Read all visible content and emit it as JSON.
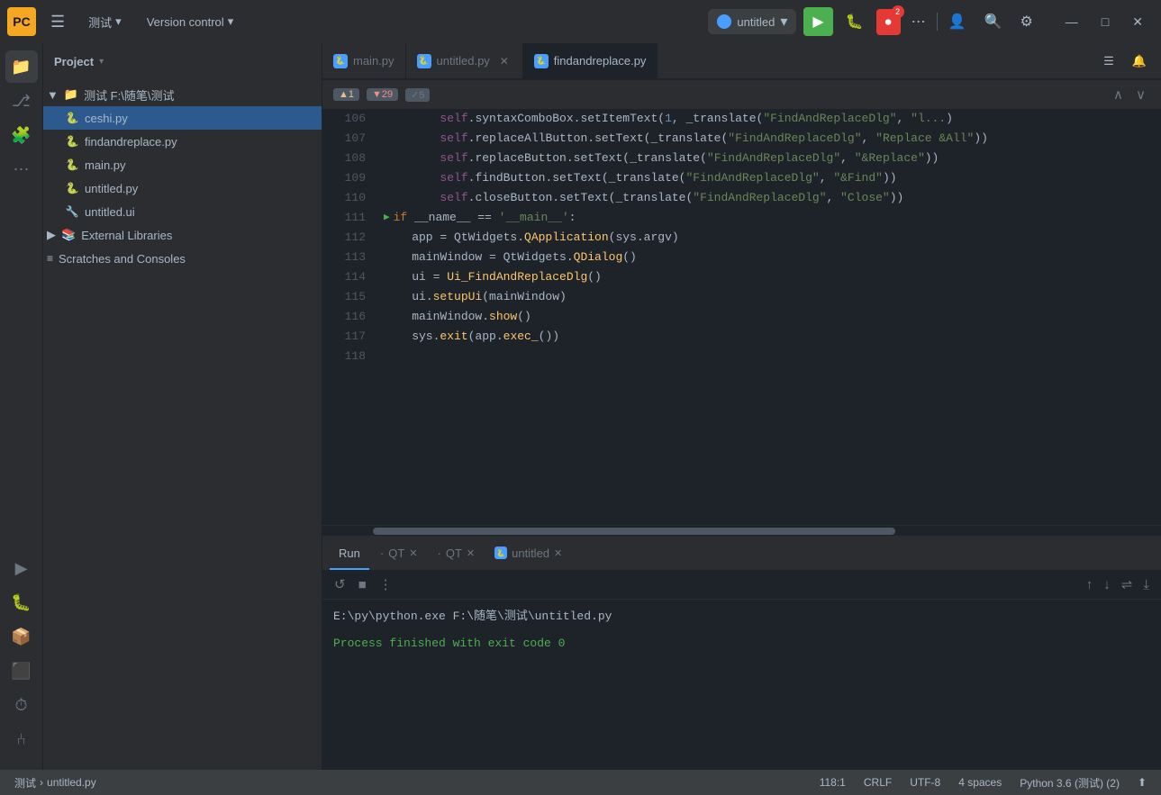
{
  "titlebar": {
    "logo": "PC",
    "menu_toggle": "☰",
    "menus": [
      {
        "label": "测试",
        "has_arrow": true
      },
      {
        "label": "Version control",
        "has_arrow": true
      }
    ],
    "project_name": "untitled",
    "run_btn": "▶",
    "debug_btn": "🐛",
    "record_btn": "⏺",
    "record_badge": "2",
    "more_btn": "⋯",
    "user_btn": "👤",
    "search_btn": "🔍",
    "settings_btn": "⚙",
    "minimize": "—",
    "maximize": "□",
    "close": "✕"
  },
  "icon_sidebar": {
    "items": [
      {
        "name": "folder-icon",
        "icon": "📁",
        "active": true
      },
      {
        "name": "git-icon",
        "icon": "⎇"
      },
      {
        "name": "plugin-icon",
        "icon": "🧩"
      },
      {
        "name": "more-tools-icon",
        "icon": "⋯"
      }
    ],
    "bottom_items": [
      {
        "name": "run-icon",
        "icon": "▶"
      },
      {
        "name": "debug-icon",
        "icon": "🐛"
      },
      {
        "name": "packages-icon",
        "icon": "📦"
      },
      {
        "name": "terminal-icon",
        "icon": "⬛"
      },
      {
        "name": "profiler-icon",
        "icon": "⏱"
      },
      {
        "name": "git-bottom-icon",
        "icon": "⑃"
      }
    ]
  },
  "file_panel": {
    "title": "Project",
    "tree": [
      {
        "type": "folder",
        "label": "测试 F:\\随笔\\测试",
        "depth": 0,
        "expanded": true,
        "icon": "folder"
      },
      {
        "type": "file",
        "label": "ceshi.py",
        "depth": 1,
        "icon": "py",
        "selected": true
      },
      {
        "type": "file",
        "label": "findandreplace.py",
        "depth": 1,
        "icon": "py",
        "selected": false
      },
      {
        "type": "file",
        "label": "main.py",
        "depth": 1,
        "icon": "py",
        "selected": false
      },
      {
        "type": "file",
        "label": "untitled.py",
        "depth": 1,
        "icon": "py",
        "selected": false
      },
      {
        "type": "file",
        "label": "untitled.ui",
        "depth": 1,
        "icon": "ui",
        "selected": false
      },
      {
        "type": "folder",
        "label": "External Libraries",
        "depth": 0,
        "expanded": false,
        "icon": "lib"
      },
      {
        "type": "folder",
        "label": "Scratches and Consoles",
        "depth": 0,
        "expanded": false,
        "icon": "scratch"
      }
    ]
  },
  "editor": {
    "tabs": [
      {
        "label": "main.py",
        "icon": "py",
        "active": false,
        "closeable": false
      },
      {
        "label": "untitled.py",
        "icon": "py",
        "active": false,
        "closeable": true
      },
      {
        "label": "findandreplace.py",
        "icon": "py",
        "active": true,
        "closeable": false
      }
    ],
    "find_info": {
      "warnings": "▲1",
      "errors": "▼29",
      "checks": "✓5"
    },
    "lines": [
      {
        "num": "106",
        "code": "        self.syntaxComboBox.setItemText(1, _translate(\"FindAndReplaceDlg\", \"l...",
        "run": false
      },
      {
        "num": "107",
        "code": "        self.replaceAllButton.setText(_translate(\"FindAndReplaceDlg\", \"Replace &All\"))",
        "run": false
      },
      {
        "num": "108",
        "code": "        self.replaceButton.setText(_translate(\"FindAndReplaceDlg\", \"&Replace\"))",
        "run": false
      },
      {
        "num": "109",
        "code": "        self.findButton.setText(_translate(\"FindAndReplaceDlg\", \"&Find\"))",
        "run": false
      },
      {
        "num": "110",
        "code": "        self.closeButton.setText(_translate(\"FindAndReplaceDlg\", \"Close\"))",
        "run": false
      },
      {
        "num": "111",
        "code": "if __name__ == '__main__':",
        "run": true
      },
      {
        "num": "112",
        "code": "    app = QtWidgets.QApplication(sys.argv)",
        "run": false
      },
      {
        "num": "113",
        "code": "    mainWindow = QtWidgets.QDialog()",
        "run": false
      },
      {
        "num": "114",
        "code": "    ui = Ui_FindAndReplaceDlg()",
        "run": false
      },
      {
        "num": "115",
        "code": "    ui.setupUi(mainWindow)",
        "run": false
      },
      {
        "num": "116",
        "code": "    mainWindow.show()",
        "run": false
      },
      {
        "num": "117",
        "code": "    sys.exit(app.exec_())",
        "run": false
      },
      {
        "num": "118",
        "code": "",
        "run": false
      }
    ]
  },
  "bottom_panel": {
    "tabs": [
      {
        "label": "Run",
        "active": true,
        "closeable": false
      },
      {
        "label": "QT",
        "active": false,
        "closeable": true
      },
      {
        "label": "QT",
        "active": false,
        "closeable": true
      },
      {
        "label": "untitled",
        "active": false,
        "closeable": true,
        "icon": "py"
      }
    ],
    "actions": {
      "rerun": "↺",
      "stop": "■",
      "more": "⋮",
      "scroll_up": "↑",
      "scroll_down": "↓",
      "wrap": "⇌",
      "scroll_end": "⤓"
    },
    "console_path": "E:\\py\\python.exe F:\\随笔\\测试\\untitled.py",
    "console_result": "Process finished with exit code 0"
  },
  "status_bar": {
    "breadcrumb_project": "测试",
    "breadcrumb_file": "untitled.py",
    "position": "118:1",
    "line_ending": "CRLF",
    "encoding": "UTF-8",
    "indent": "4 spaces",
    "python_version": "Python 3.6 (测试) (2)",
    "git_icon": "⬆"
  }
}
